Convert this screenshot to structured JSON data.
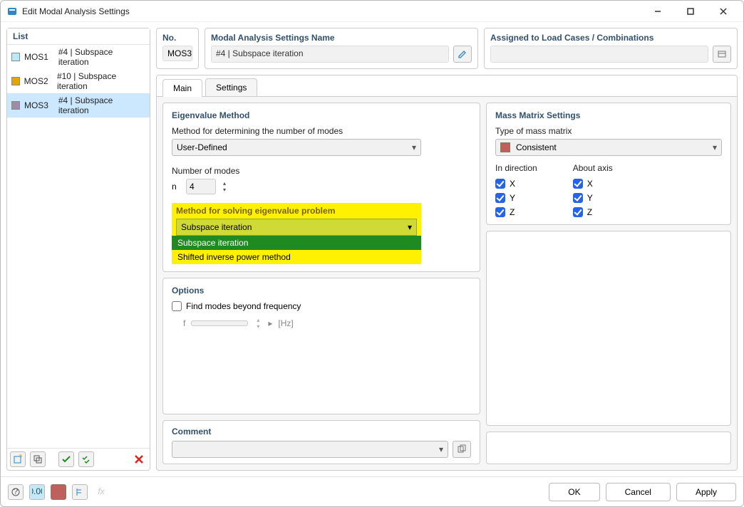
{
  "window": {
    "title": "Edit Modal Analysis Settings"
  },
  "list": {
    "header": "List",
    "items": [
      {
        "code": "MOS1",
        "label": "#4 | Subspace iteration",
        "swatch": "#b9e9f4"
      },
      {
        "code": "MOS2",
        "label": "#10 | Subspace iteration",
        "swatch": "#e5a400"
      },
      {
        "code": "MOS3",
        "label": "#4 | Subspace iteration",
        "swatch": "#9f8aa7"
      }
    ],
    "selected_index": 2
  },
  "no": {
    "title": "No.",
    "value": "MOS3"
  },
  "name": {
    "title": "Modal Analysis Settings Name",
    "value": "#4 | Subspace iteration"
  },
  "assigned": {
    "title": "Assigned to Load Cases / Combinations",
    "value": ""
  },
  "tabs": {
    "main": "Main",
    "settings": "Settings",
    "active": "main"
  },
  "eigen": {
    "title": "Eigenvalue Method",
    "method_label": "Method for determining the number of modes",
    "method_value": "User-Defined",
    "num_label": "Number of modes",
    "num_letter": "n",
    "num_value": "4",
    "solve_label": "Method for solving eigenvalue problem",
    "solve_value": "Subspace iteration",
    "solve_options": [
      "Subspace iteration",
      "Shifted inverse power method"
    ],
    "solve_selected_index": 0
  },
  "options": {
    "title": "Options",
    "find_label": "Find modes beyond frequency",
    "find_checked": false,
    "f_letter": "f",
    "f_unit": "[Hz]"
  },
  "mass": {
    "title": "Mass Matrix Settings",
    "type_label": "Type of mass matrix",
    "type_value": "Consistent",
    "in_dir": "In direction",
    "about_axis": "About axis",
    "dir": {
      "x": "X",
      "y": "Y",
      "z": "Z"
    },
    "checks": {
      "dx": true,
      "dy": true,
      "dz": true,
      "ax": true,
      "ay": true,
      "az": true
    }
  },
  "comment": {
    "title": "Comment",
    "value": ""
  },
  "footer": {
    "ok": "OK",
    "cancel": "Cancel",
    "apply": "Apply"
  }
}
